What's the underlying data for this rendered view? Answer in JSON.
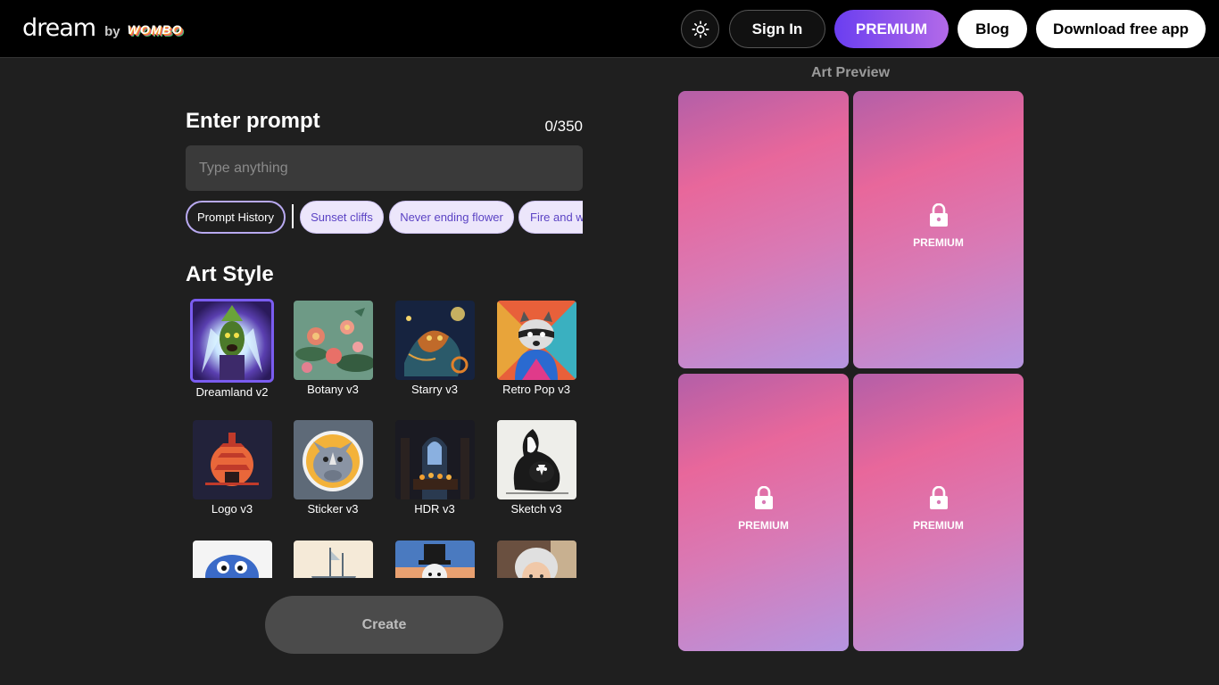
{
  "header": {
    "logo_text": "dream",
    "logo_by": "by",
    "logo_brand": "WOMBO",
    "theme_icon": "sun-icon",
    "signin_label": "Sign In",
    "premium_label": "PREMIUM",
    "blog_label": "Blog",
    "download_label": "Download free app"
  },
  "prompt": {
    "title": "Enter prompt",
    "count": "0/350",
    "placeholder": "Type anything",
    "history_label": "Prompt History",
    "suggestions": [
      "Sunset cliffs",
      "Never ending flower",
      "Fire and w"
    ]
  },
  "art_style": {
    "title": "Art Style",
    "items": [
      {
        "label": "Dreamland v2",
        "selected": true
      },
      {
        "label": "Botany v3"
      },
      {
        "label": "Starry v3"
      },
      {
        "label": "Retro Pop v3"
      },
      {
        "label": "Logo v3"
      },
      {
        "label": "Sticker v3"
      },
      {
        "label": "HDR v3"
      },
      {
        "label": "Sketch v3"
      },
      {
        "label": ""
      },
      {
        "label": ""
      },
      {
        "label": ""
      },
      {
        "label": ""
      }
    ]
  },
  "create_label": "Create",
  "preview": {
    "title": "Art Preview",
    "cards": [
      {
        "locked": false,
        "label": ""
      },
      {
        "locked": true,
        "label": "PREMIUM"
      },
      {
        "locked": true,
        "label": "PREMIUM"
      },
      {
        "locked": true,
        "label": "PREMIUM"
      }
    ]
  },
  "colors": {
    "accent": "#7a5cf0",
    "premium_gradient_start": "#6a3ef0",
    "premium_gradient_end": "#b36ae8"
  }
}
